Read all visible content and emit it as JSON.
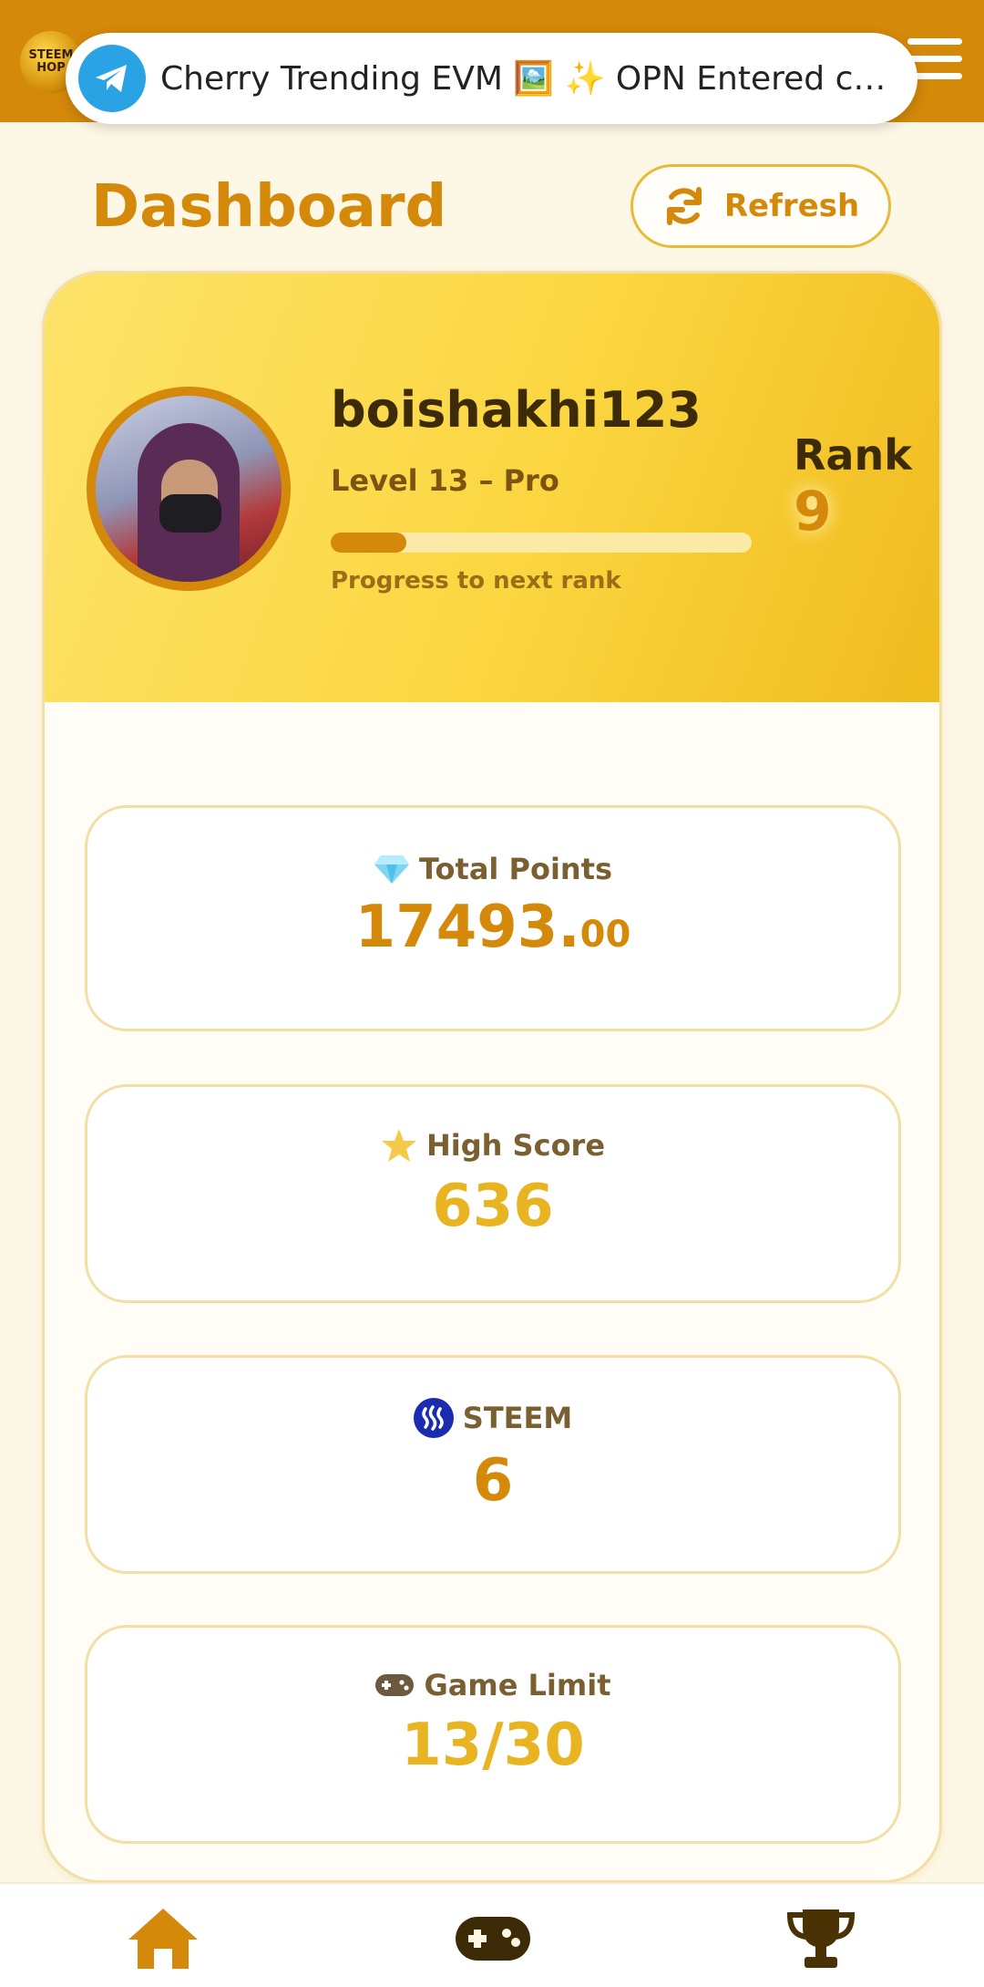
{
  "notification": {
    "text": "Cherry Trending EVM 🖼️ ✨ OPN Entered cher..."
  },
  "header": {
    "logo_text": "STEEM HOP"
  },
  "page": {
    "title": "Dashboard",
    "refresh_label": "Refresh"
  },
  "profile": {
    "username": "boishakhi123",
    "level": "Level 13 – Pro",
    "progress_caption": "Progress to next rank",
    "progress_fraction": 0.18,
    "rank_label": "Rank",
    "rank_value": "9"
  },
  "stats": [
    {
      "icon": "diamond-icon",
      "label": "Total Points",
      "value_main": "17493.",
      "value_decimal": "00",
      "color": "#d4890a"
    },
    {
      "icon": "star-icon",
      "label": "High Score",
      "value_main": "636",
      "value_decimal": "",
      "color": "#e9b421"
    },
    {
      "icon": "steem-icon",
      "label": "STEEM",
      "value_main": "6",
      "value_decimal": "",
      "color": "#d4890a"
    },
    {
      "icon": "gamepad-icon",
      "label": "Game Limit",
      "value_main": "13/30",
      "value_decimal": "",
      "color": "#e9b421"
    }
  ],
  "nav": {
    "items": [
      "home-icon",
      "gamepad-icon",
      "trophy-icon"
    ]
  },
  "colors": {
    "accent": "#d4890a",
    "banner_gold": "#fbd640",
    "background": "#fdf7e6",
    "dark_text": "#3d2a07"
  }
}
